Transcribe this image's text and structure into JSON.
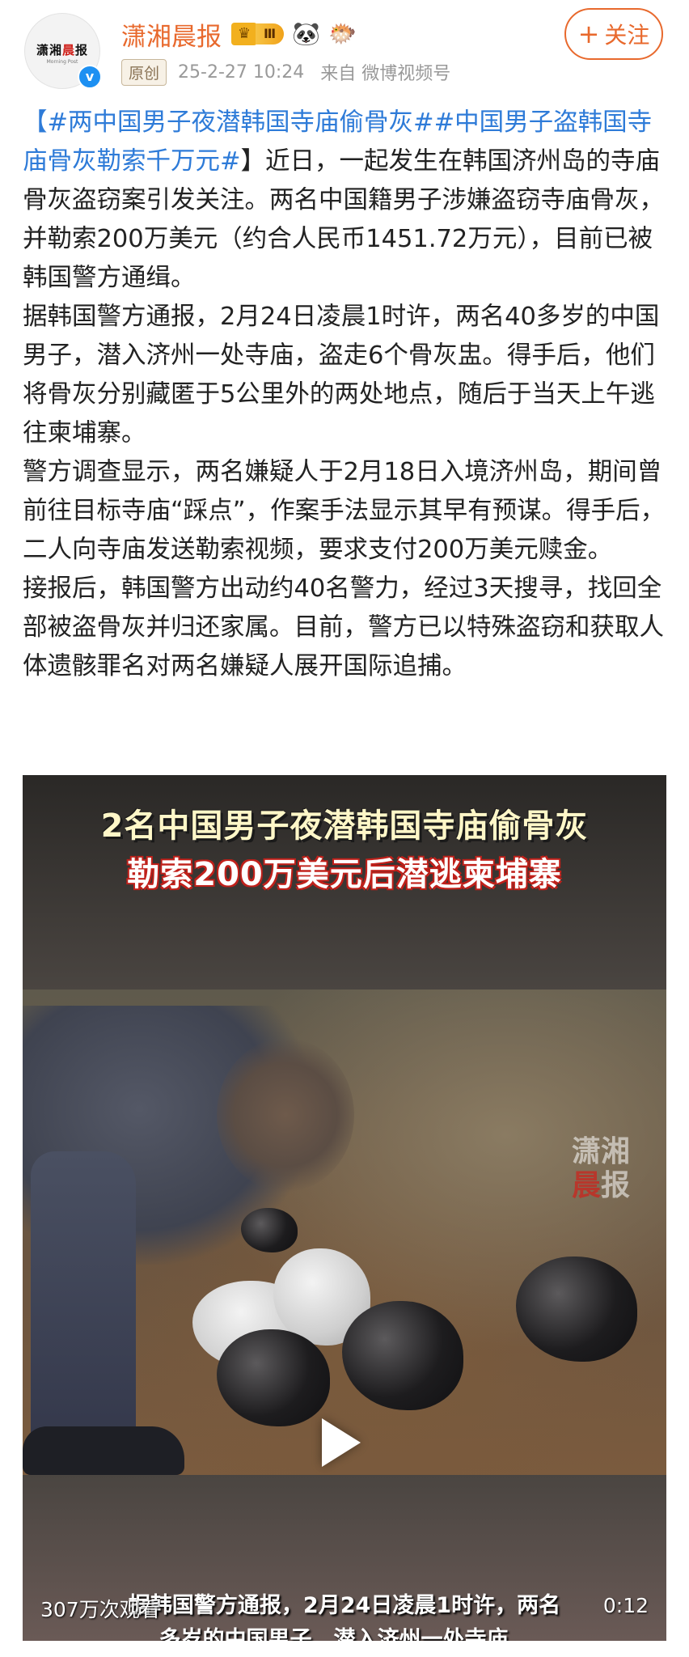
{
  "header": {
    "avatar_logo_black": "潇湘",
    "avatar_logo_red": "晨",
    "avatar_logo_black2": "报",
    "avatar_logo_sub": "Morning Post",
    "verified_mark": "v",
    "username": "潇湘晨报",
    "vip_level": "Ⅲ",
    "original_tag": "原创",
    "timestamp": "25-2-27 10:24",
    "source": "来自 微博视频号",
    "follow_label": "关注",
    "follow_plus": "+"
  },
  "post": {
    "topic1": "【#两中国男子夜潜韩国寺庙偷骨灰##中国男子盗韩国寺庙骨灰勒索千万元#",
    "para1_rest": "】近日，一起发生在韩国济州岛的寺庙骨灰盗窃案引发关注。两名中国籍男子涉嫌盗窃寺庙骨灰，并勒索200万美元（约合人民币1451.72万元），目前已被韩国警方通缉。",
    "para2": "据韩国警方通报，2月24日凌晨1时许，两名40多岁的中国男子，潜入济州一处寺庙，盗走6个骨灰盅。得手后，他们将骨灰分别藏匿于5公里外的两处地点，随后于当天上午逃往柬埔寨。",
    "para3": "警方调查显示，两名嫌疑人于2月18日入境济州岛，期间曾前往目标寺庙“踩点”，作案手法显示其早有预谋。得手后，二人向寺庙发送勒索视频，要求支付200万美元赎金。",
    "para4": "接报后，韩国警方出动约40名警力，经过3天搜寻，找回全部被盗骨灰并归还家属。目前，警方已以特殊盗窃和获取人体遗骸罪名对两名嫌疑人展开国际追捕。"
  },
  "video": {
    "caption_line1": "2名中国男子夜潜韩国寺庙偷骨灰",
    "caption_line2": "勒索200万美元后潜逃柬埔寨",
    "watermark_line1": "潇湘",
    "watermark_line2_red": "晨",
    "watermark_line2": "报",
    "subtitle_line1": "据韩国警方通报，2月24日凌晨1时许，两名",
    "subtitle_line2": "多岁的中国男子，潜入济州一处寺庙，",
    "views": "307万次观看",
    "duration": "0:12"
  },
  "colors": {
    "brand_orange": "#e8692d",
    "topic_blue": "#2e7bd8",
    "verified_blue": "#1d90f2"
  }
}
